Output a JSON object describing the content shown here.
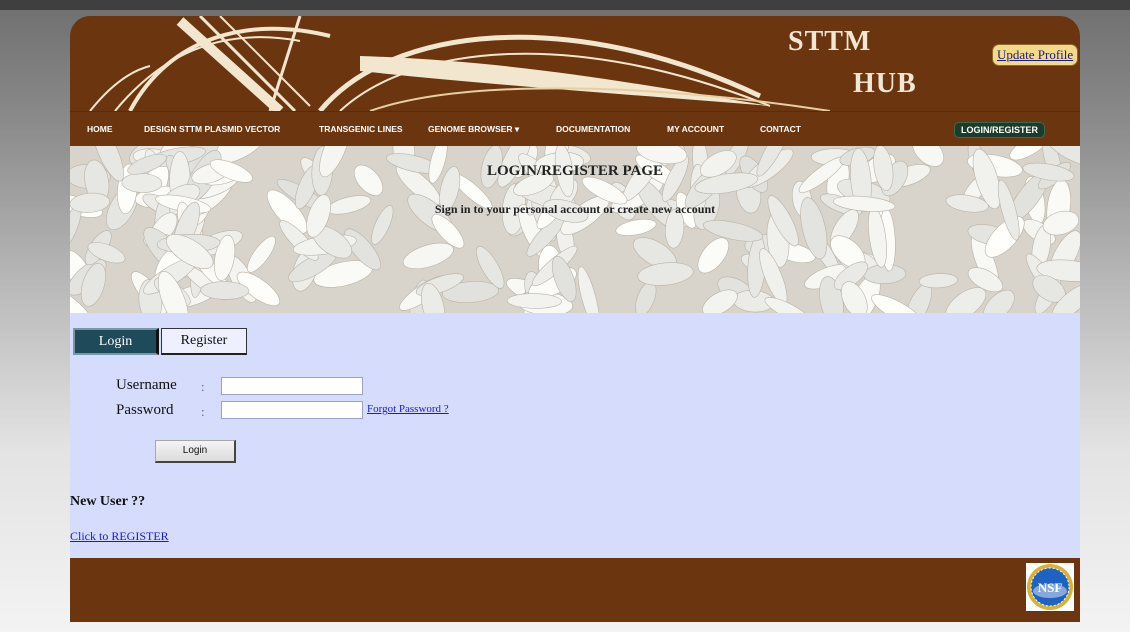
{
  "header": {
    "brand_line1": "STTM",
    "brand_line2": "HUB",
    "update_profile": "Update Profile"
  },
  "nav": {
    "items": [
      "HOME",
      "DESIGN STTM PLASMID VECTOR",
      "TRANSGENIC LINES",
      "GENOME BROWSER ▾",
      "DOCUMENTATION",
      "MY ACCOUNT",
      "CONTACT"
    ],
    "login_register": "LOGIN/REGISTER"
  },
  "banner": {
    "title": "LOGIN/REGISTER PAGE",
    "subtitle": "Sign in to your personal account or create new account"
  },
  "tabs": {
    "login": "Login",
    "register": "Register",
    "active": "Login"
  },
  "form": {
    "username_label": "Username",
    "password_label": "Password",
    "separator": ":",
    "username_value": "",
    "password_value": "",
    "forgot_password": "Forgot Password ?",
    "submit": "Login"
  },
  "new_user": {
    "heading": "New User ??",
    "register_link": "Click to REGISTER"
  },
  "footer": {
    "logo_text": "NSF"
  },
  "colors": {
    "brown": "#6b3510",
    "content_bg": "#d6dcfc",
    "tab_active": "#1f4a5a",
    "nav_login_bg": "#1d3b2a",
    "profile_button": "#f4d98a",
    "link": "#1a1ad0"
  }
}
